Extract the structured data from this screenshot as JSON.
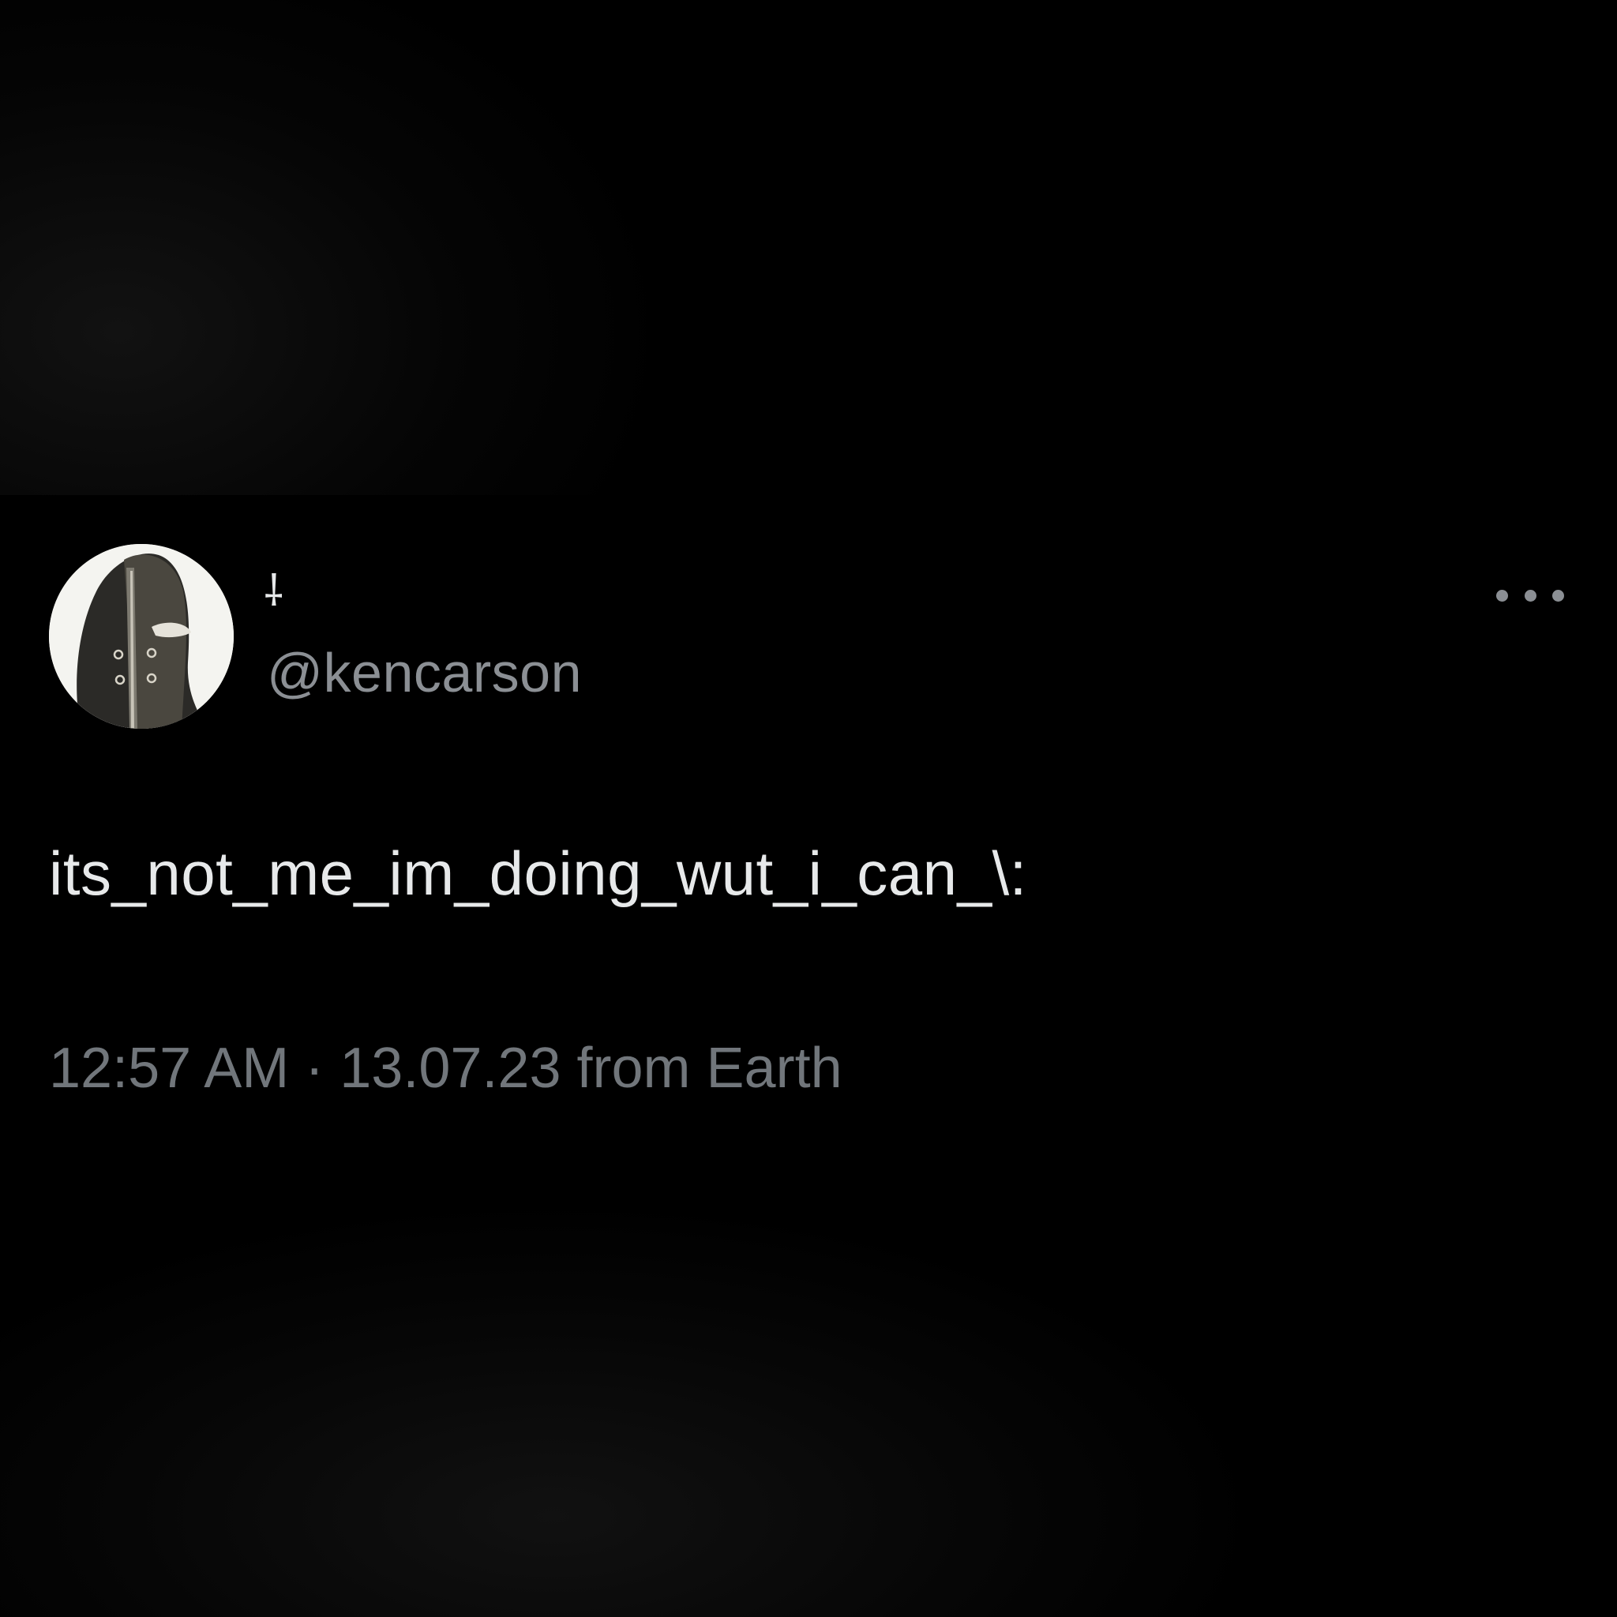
{
  "tweet": {
    "display_name": "⸸",
    "handle": "@kencarson",
    "text": "its_not_me_im_doing_wut_i_can_\\:",
    "time": "12:57 AM",
    "separator": "·",
    "date": "13.07.23",
    "source": "from Earth"
  },
  "icons": {
    "more": "more-horizontal-icon",
    "avatar": "masked-figure-avatar"
  },
  "colors": {
    "background": "#000000",
    "primary_text": "#e7e9ea",
    "secondary_text": "#71767b"
  }
}
